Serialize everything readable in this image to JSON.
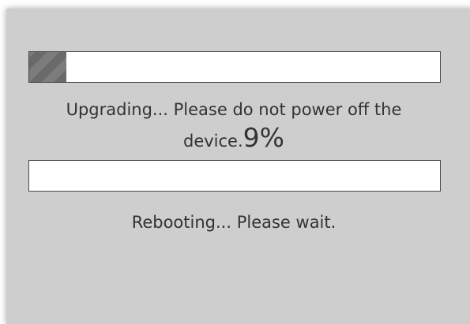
{
  "upgrade": {
    "message": "Upgrading... Please do not power off the device.",
    "percent_label": "9%",
    "progress_fraction": 0.09
  },
  "reboot": {
    "message": "Rebooting... Please wait.",
    "progress_fraction": 0
  },
  "colors": {
    "panel_background": "#cecece",
    "bar_fill": "#6e6e6e",
    "bar_border": "#4a4a4a",
    "text": "#333333"
  }
}
